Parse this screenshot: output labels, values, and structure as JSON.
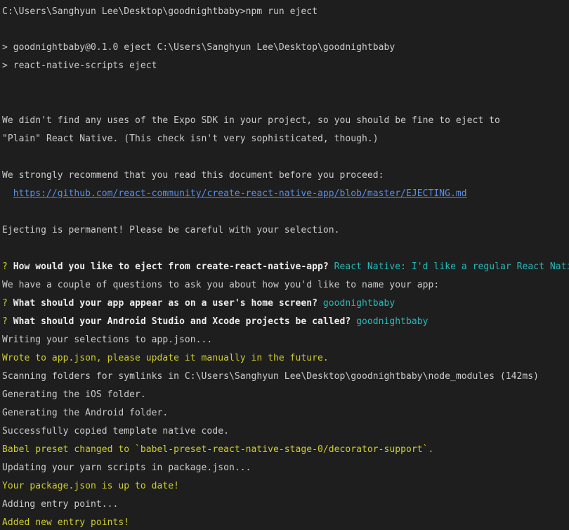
{
  "terminal": {
    "prompt_command": "C:\\Users\\Sanghyun Lee\\Desktop\\goodnightbaby>npm run eject",
    "script_line_1": "> goodnightbaby@0.1.0 eject C:\\Users\\Sanghyun Lee\\Desktop\\goodnightbaby",
    "script_line_2": "> react-native-scripts eject",
    "expo_msg_1": "We didn't find any uses of the Expo SDK in your project, so you should be fine to eject to",
    "expo_msg_2": "\"Plain\" React Native. (This check isn't very sophisticated, though.)",
    "recommend": "We strongly recommend that you read this document before you proceed:",
    "doc_link": "https://github.com/react-community/create-react-native-app/blob/master/EJECTING.md",
    "permanent": "Ejecting is permanent! Please be careful with your selection.",
    "q1": {
      "mark": "?",
      "question": "How would you like to eject from create-react-native-app?",
      "answer": "React Native: I'd like a regular React Native project."
    },
    "couple_questions": "We have a couple of questions to ask you about how you'd like to name your app:",
    "q2": {
      "mark": "?",
      "question": "What should your app appear as on a user's home screen?",
      "answer": "goodnightbaby"
    },
    "q3": {
      "mark": "?",
      "question": "What should your Android Studio and Xcode projects be called?",
      "answer": "goodnightbaby"
    },
    "writing": "Writing your selections to app.json...",
    "wrote": "Wrote to app.json, please update it manually in the future.",
    "scanning": "Scanning folders for symlinks in C:\\Users\\Sanghyun Lee\\Desktop\\goodnightbaby\\node_modules (142ms)",
    "gen_ios": "Generating the iOS folder.",
    "gen_android": "Generating the Android folder.",
    "copied": "Successfully copied template native code.",
    "babel": "Babel preset changed to `babel-preset-react-native-stage-0/decorator-support`.",
    "updating_yarn": "Updating your yarn scripts in package.json...",
    "package_ok": "Your package.json is up to date!",
    "adding_entry": "Adding entry point...",
    "added_entry": "Added new entry points!"
  },
  "colors": {
    "background": "#1e1e1e",
    "default_text": "#cccccc",
    "yellow": "#cdcd2e",
    "cyan": "#28b8b8",
    "link": "#5b8fe6"
  }
}
